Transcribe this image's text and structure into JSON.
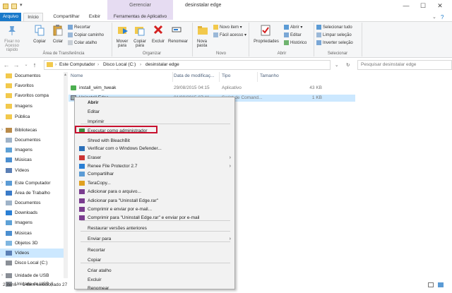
{
  "window": {
    "manage_tab": "Gerenciar",
    "title": "desinstalar edge",
    "min": "—",
    "max": "☐",
    "close": "✕"
  },
  "tabs": [
    "Arquivo",
    "Início",
    "Compartilhar",
    "Exibir",
    "Ferramentas de Aplicativo"
  ],
  "ribbon": {
    "pin_label": "Fixar no Acesso rápido",
    "copy_label": "Copiar",
    "paste_label": "Colar",
    "cut_label": "Recortar",
    "copy_path_label": "Copiar caminho",
    "paste_shortcut_label": "Colar atalho",
    "move_label": "Mover para",
    "copy_to_label": "Copiar para",
    "delete_label": "Excluir",
    "rename_label": "Renomear",
    "new_folder_label": "Nova pasta",
    "new_item_label": "Novo item",
    "easy_access_label": "Fácil acesso",
    "properties_label": "Propriedades",
    "open_label": "Abrir",
    "edit_label": "Editar",
    "history_label": "Histórico",
    "select_all_label": "Selecionar tudo",
    "clear_selection_label": "Limpar seleção",
    "invert_selection_label": "Inverter seleção",
    "group_clipboard": "Área de Transferência",
    "group_organize": "Organizar",
    "group_new": "Novo",
    "group_open": "Abrir",
    "group_select": "Selecionar"
  },
  "address": {
    "crumbs": [
      "Este Computador",
      "Disco Local (C:)",
      "desinstalar edge"
    ],
    "search_placeholder": "Pesquisar desinstalar edge"
  },
  "nav": [
    {
      "label": "Documentos",
      "icon": "folder-icon"
    },
    {
      "label": "Favoritos",
      "icon": "folder-icon"
    },
    {
      "label": "Favoritos compa",
      "icon": "folder-icon"
    },
    {
      "label": "Imagens",
      "icon": "folder-icon"
    },
    {
      "label": "Pública",
      "icon": "folder-icon"
    },
    {
      "label": "Bibliotecas",
      "icon": "library-icon"
    },
    {
      "label": "Documentos",
      "icon": "documents-icon"
    },
    {
      "label": "Imagens",
      "icon": "pictures-icon"
    },
    {
      "label": "Músicas",
      "icon": "music-icon"
    },
    {
      "label": "Vídeos",
      "icon": "videos-icon"
    },
    {
      "label": "Este Computador",
      "icon": "computer-icon"
    },
    {
      "label": "Área de Trabalho",
      "icon": "desktop-icon"
    },
    {
      "label": "Documentos",
      "icon": "documents-icon"
    },
    {
      "label": "Downloads",
      "icon": "downloads-icon"
    },
    {
      "label": "Imagens",
      "icon": "pictures-icon"
    },
    {
      "label": "Músicas",
      "icon": "music-icon"
    },
    {
      "label": "Objetos 3D",
      "icon": "objects3d-icon"
    },
    {
      "label": "Vídeos",
      "icon": "videos-icon"
    },
    {
      "label": "Disco Local (C:)",
      "icon": "drive-icon"
    },
    {
      "label": "Unidade de USB",
      "icon": "usb-icon"
    },
    {
      "label": "Unidade de USB (I",
      "icon": "usb-icon"
    }
  ],
  "columns": {
    "name": "Nome",
    "date": "Data de modificaç...",
    "type": "Tipo",
    "size": "Tamanho"
  },
  "files": [
    {
      "name": "install_wim_tweak",
      "date": "29/08/2015 04:15",
      "type": "Aplicativo",
      "size": "43 KB"
    },
    {
      "name": "Uninstall Edge",
      "date": "01/09/2015 07:41",
      "type": "Script de Comand...",
      "size": "1 KB"
    }
  ],
  "status": {
    "count": "2 itens",
    "selected": "1 item selecionado 27"
  },
  "context_menu": [
    {
      "label": "Abrir",
      "bold": true
    },
    {
      "label": "Editar"
    },
    {
      "label": "Imprimir"
    },
    {
      "label": "Executar como administrador",
      "icon": "shield-icon"
    },
    {
      "label": "Shred with BleachBit"
    },
    {
      "label": "Verificar com o Windows Defender...",
      "icon": "defender-icon"
    },
    {
      "label": "Eraser",
      "icon": "eraser-icon",
      "submenu": true
    },
    {
      "label": "Renee File Protector 2.7",
      "icon": "lock-icon",
      "submenu": true
    },
    {
      "label": "Compartilhar",
      "icon": "share-icon"
    },
    {
      "label": "TeraCopy...",
      "icon": "teracopy-icon"
    },
    {
      "label": "Adicionar para o arquivo...",
      "icon": "winrar-icon"
    },
    {
      "label": "Adicionar para \"Uninstall Edge.rar\"",
      "icon": "winrar-icon"
    },
    {
      "label": "Comprimir e enviar por e-mail...",
      "icon": "winrar-icon"
    },
    {
      "label": "Comprimir para \"Uninstall Edge.rar\" e enviar por e-mail",
      "icon": "winrar-icon"
    },
    {
      "label": "Restaurar versões anteriores"
    },
    {
      "label": "Enviar para",
      "submenu": true
    },
    {
      "label": "Recortar"
    },
    {
      "label": "Copiar"
    },
    {
      "label": "Criar atalho"
    },
    {
      "label": "Excluir"
    },
    {
      "label": "Renomear"
    }
  ],
  "colors": {
    "accent": "#1979ca",
    "selection": "#cce8ff",
    "highlight_border": "#c8102e",
    "manage_bg": "#e6dcf2"
  }
}
